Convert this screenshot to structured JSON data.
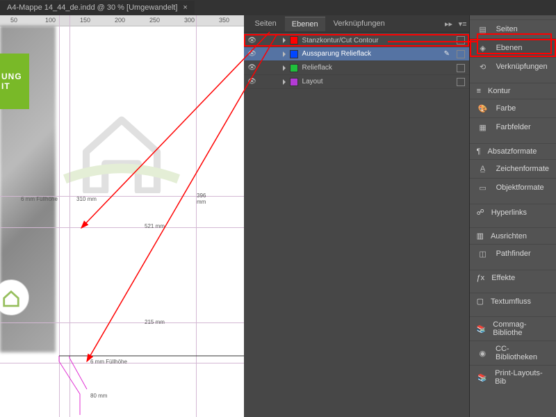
{
  "document": {
    "title": "A4-Mappe 14_44_de.indd @ 30 % [Umgewandelt]"
  },
  "ruler": [
    "50",
    "100",
    "150",
    "200",
    "250",
    "300",
    "350"
  ],
  "greenBox": {
    "line1": "UNG",
    "line2": "IT"
  },
  "measurements": {
    "fill_left": "6 mm Füllhöhe",
    "w310": "310 mm",
    "w396": "396\nmm",
    "w521": "521 mm",
    "w215": "215 mm",
    "fill_bottom": "6 mm Füllhöhe",
    "w80": "80 mm"
  },
  "panel": {
    "tabs": [
      "Seiten",
      "Ebenen",
      "Verknüpfungen"
    ],
    "active": 1
  },
  "layers": [
    {
      "name": "Stanzkontur/Cut Contour",
      "color": "#ff0000",
      "selected": false,
      "highlight": true,
      "pen": false
    },
    {
      "name": "Aussparung Relieflack",
      "color": "#0046ff",
      "selected": true,
      "highlight": false,
      "pen": true
    },
    {
      "name": "Relieflack",
      "color": "#1fbf3b",
      "selected": false,
      "highlight": false,
      "pen": false
    },
    {
      "name": "Layout",
      "color": "#b43bd6",
      "selected": false,
      "highlight": false,
      "pen": false
    }
  ],
  "rightPanelGroups": [
    [
      {
        "icon": "pages",
        "label": "Seiten"
      },
      {
        "icon": "layers",
        "label": "Ebenen",
        "highlight": true
      },
      {
        "icon": "links",
        "label": "Verknüpfungen"
      }
    ],
    [
      {
        "icon": "stroke",
        "label": "Kontur"
      },
      {
        "icon": "color",
        "label": "Farbe"
      },
      {
        "icon": "swatches",
        "label": "Farbfelder"
      }
    ],
    [
      {
        "icon": "para",
        "label": "Absatzformate"
      },
      {
        "icon": "char",
        "label": "Zeichenformate"
      },
      {
        "icon": "obj",
        "label": "Objektformate"
      }
    ],
    [
      {
        "icon": "hyper",
        "label": "Hyperlinks"
      }
    ],
    [
      {
        "icon": "align",
        "label": "Ausrichten"
      },
      {
        "icon": "pathfinder",
        "label": "Pathfinder"
      }
    ],
    [
      {
        "icon": "fx",
        "label": "Effekte"
      }
    ],
    [
      {
        "icon": "wrap",
        "label": "Textumfluss"
      }
    ],
    [
      {
        "icon": "lib",
        "label": "Commag-Bibliothe"
      },
      {
        "icon": "cc",
        "label": "CC-Bibliotheken"
      },
      {
        "icon": "lib",
        "label": "Print-Layouts-Bib"
      }
    ]
  ],
  "colors": {
    "accent_red": "#ff0000"
  }
}
